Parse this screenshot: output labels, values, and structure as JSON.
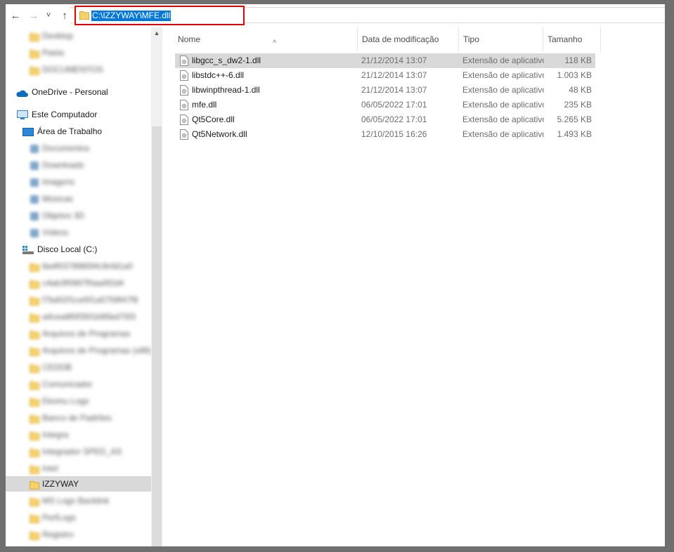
{
  "addressbar": {
    "path": "C:\\IZZYWAY\\MFE.dll",
    "back_icon": "←",
    "forward_icon": "→",
    "recent_icon": "˅",
    "up_icon": "↑"
  },
  "sidebar": {
    "items": [
      {
        "label": "Desktop",
        "icon": "folder-icon",
        "blurred": true
      },
      {
        "label": "Pasta",
        "icon": "folder-icon",
        "blurred": true
      },
      {
        "label": "DOCUMENTOS",
        "icon": "folder-icon",
        "blurred": true
      },
      {
        "label": "OneDrive - Personal",
        "icon": "onedrive-icon",
        "blurred": false
      },
      {
        "label": "Este Computador",
        "icon": "computer-icon",
        "blurred": false
      },
      {
        "label": "Área de Trabalho",
        "icon": "desktop-icon",
        "blurred": false
      },
      {
        "label": "Documentos",
        "icon": "documents-icon",
        "blurred": true
      },
      {
        "label": "Downloads",
        "icon": "downloads-icon",
        "blurred": true
      },
      {
        "label": "Imagens",
        "icon": "pictures-icon",
        "blurred": true
      },
      {
        "label": "Músicas",
        "icon": "music-icon",
        "blurred": true
      },
      {
        "label": "Objetos 3D",
        "icon": "objects-3d-icon",
        "blurred": true
      },
      {
        "label": "Vídeos",
        "icon": "videos-icon",
        "blurred": true
      },
      {
        "label": "Disco Local (C:)",
        "icon": "drive-icon",
        "blurred": false
      },
      {
        "label": "8a4f0378965f4c9cfd1a0",
        "icon": "folder-icon",
        "blurred": true
      },
      {
        "label": "c4ab3f0997f0aa0f2d4",
        "icon": "folder-icon",
        "blurred": true
      },
      {
        "label": "f7bd02f1ce5f1a5759f47f9",
        "icon": "folder-icon",
        "blurred": true
      },
      {
        "label": "a4cea8f0f35f1b95bd75f3",
        "icon": "folder-icon",
        "blurred": true
      },
      {
        "label": "Arquivos de Programas",
        "icon": "folder-icon",
        "blurred": true
      },
      {
        "label": "Arquivos de Programas (x86)",
        "icon": "folder-icon",
        "blurred": true
      },
      {
        "label": "CEDDB",
        "icon": "folder-icon",
        "blurred": true
      },
      {
        "label": "Comunicador",
        "icon": "folder-icon",
        "blurred": true
      },
      {
        "label": "Ekomu Logs",
        "icon": "folder-icon",
        "blurred": true
      },
      {
        "label": "Banco de Padrões",
        "icon": "folder-icon",
        "blurred": true
      },
      {
        "label": "Integra",
        "icon": "folder-icon",
        "blurred": true
      },
      {
        "label": "Integrador SPED_AS",
        "icon": "folder-icon",
        "blurred": true
      },
      {
        "label": "Intel",
        "icon": "folder-icon",
        "blurred": true
      },
      {
        "label": "IZZYWAY",
        "icon": "folder-icon",
        "blurred": false,
        "selected": true
      },
      {
        "label": "MS Logs Backlink",
        "icon": "folder-icon",
        "blurred": true
      },
      {
        "label": "PerfLogs",
        "icon": "folder-icon",
        "blurred": true
      },
      {
        "label": "Registro",
        "icon": "folder-icon",
        "blurred": true
      }
    ]
  },
  "columns": {
    "name": "Nome",
    "date": "Data de modificação",
    "type": "Tipo",
    "size": "Tamanho"
  },
  "files": [
    {
      "name": "libgcc_s_dw2-1.dll",
      "date": "21/12/2014 13:07",
      "type": "Extensão de aplicativo",
      "size": "118 KB"
    },
    {
      "name": "libstdc++-6.dll",
      "date": "21/12/2014 13:07",
      "type": "Extensão de aplicativo",
      "size": "1.003 KB"
    },
    {
      "name": "libwinpthread-1.dll",
      "date": "21/12/2014 13:07",
      "type": "Extensão de aplicativo",
      "size": "48 KB"
    },
    {
      "name": "mfe.dll",
      "date": "06/05/2022 17:01",
      "type": "Extensão de aplicativo",
      "size": "235 KB"
    },
    {
      "name": "Qt5Core.dll",
      "date": "06/05/2022 17:01",
      "type": "Extensão de aplicativo",
      "size": "5.265 KB"
    },
    {
      "name": "Qt5Network.dll",
      "date": "12/10/2015 16:26",
      "type": "Extensão de aplicativo",
      "size": "1.493 KB"
    }
  ],
  "colors": {
    "selection": "#d9d9d9",
    "address_highlight": "#0078d7",
    "annotation_box": "#e00000",
    "folder": "#f6d36a"
  }
}
